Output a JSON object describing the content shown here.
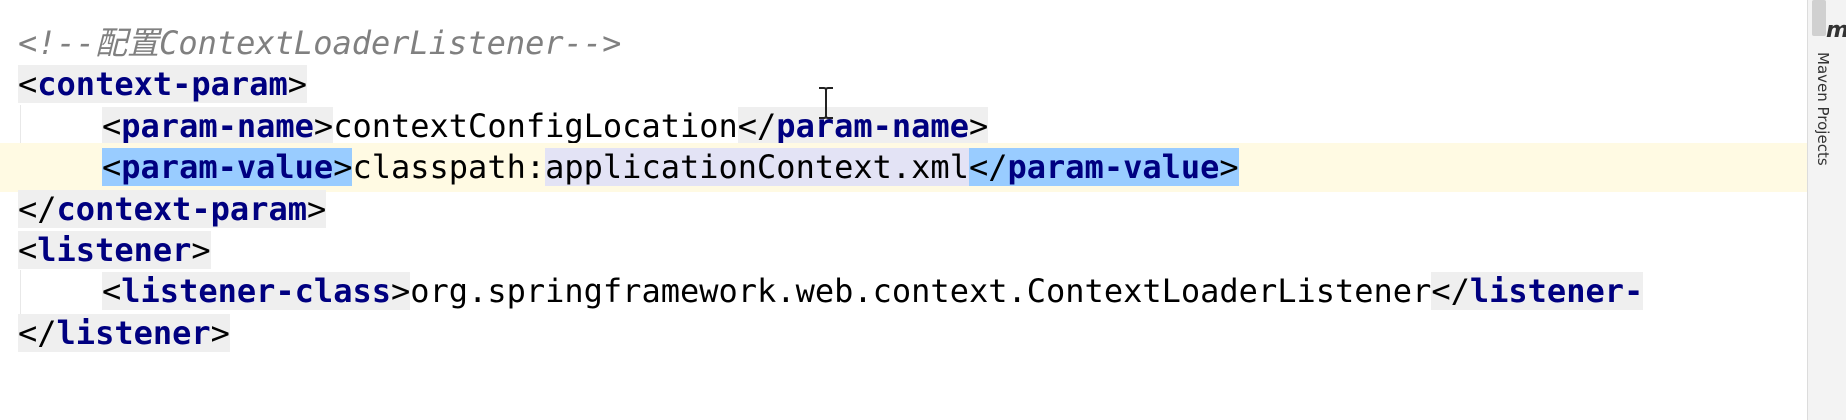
{
  "editor": {
    "line1": {
      "comment": "<!--配置ContextLoaderListener-->"
    },
    "line2": {
      "open": "context-param"
    },
    "line3": {
      "open": "param-name",
      "text": "contextConfigLocation",
      "close": "param-name"
    },
    "line4": {
      "open": "param-value",
      "text_a": "classpath:",
      "text_b": "applicationContext.xml",
      "close": "param-value"
    },
    "line5": {
      "close": "context-param"
    },
    "line6": {
      "open": "listener"
    },
    "line7": {
      "open": "listener-class",
      "text": "org.springframework.web.context.ContextLoaderListener",
      "close_partial": "listener-"
    },
    "line8": {
      "close": "listener"
    }
  },
  "sidebar": {
    "icon_letter": "m",
    "tab_label": "Maven Projects"
  }
}
